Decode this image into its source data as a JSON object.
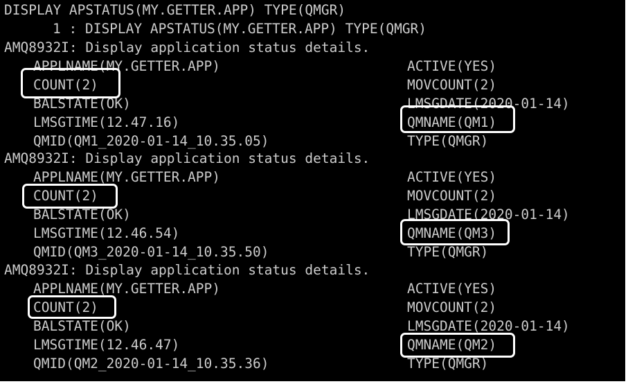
{
  "terminal": {
    "command": "DISPLAY APSTATUS(MY.GETTER.APP) TYPE(QMGR)",
    "echo": "1 : DISPLAY APSTATUS(MY.GETTER.APP) TYPE(QMGR)",
    "blocks": [
      {
        "header": "AMQ8932I: Display application status details.",
        "applname": "APPLNAME(MY.GETTER.APP)",
        "active": "ACTIVE(YES)",
        "count": "COUNT(2)",
        "movcount": "MOVCOUNT(2)",
        "balstate": "BALSTATE(OK)",
        "lmsgdate": "LMSGDATE(2020-01-14)",
        "lmsgtime": "LMSGTIME(12.47.16)",
        "qmname": "QMNAME(QM1)",
        "qmid": "QMID(QM1_2020-01-14_10.35.05)",
        "type": "TYPE(QMGR)"
      },
      {
        "header": "AMQ8932I: Display application status details.",
        "applname": "APPLNAME(MY.GETTER.APP)",
        "active": "ACTIVE(YES)",
        "count": "COUNT(2)",
        "movcount": "MOVCOUNT(2)",
        "balstate": "BALSTATE(OK)",
        "lmsgdate": "LMSGDATE(2020-01-14)",
        "lmsgtime": "LMSGTIME(12.46.54)",
        "qmname": "QMNAME(QM3)",
        "qmid": "QMID(QM3_2020-01-14_10.35.50)",
        "type": "TYPE(QMGR)"
      },
      {
        "header": "AMQ8932I: Display application status details.",
        "applname": "APPLNAME(MY.GETTER.APP)",
        "active": "ACTIVE(YES)",
        "count": "COUNT(2)",
        "movcount": "MOVCOUNT(2)",
        "balstate": "BALSTATE(OK)",
        "lmsgdate": "LMSGDATE(2020-01-14)",
        "lmsgtime": "LMSGTIME(12.46.47)",
        "qmname": "QMNAME(QM2)",
        "qmid": "QMID(QM2_2020-01-14_10.35.36)",
        "type": "TYPE(QMGR)"
      }
    ]
  },
  "colors": {
    "background": "#000000",
    "text": "#cccccc",
    "highlight": "#ffffff"
  }
}
